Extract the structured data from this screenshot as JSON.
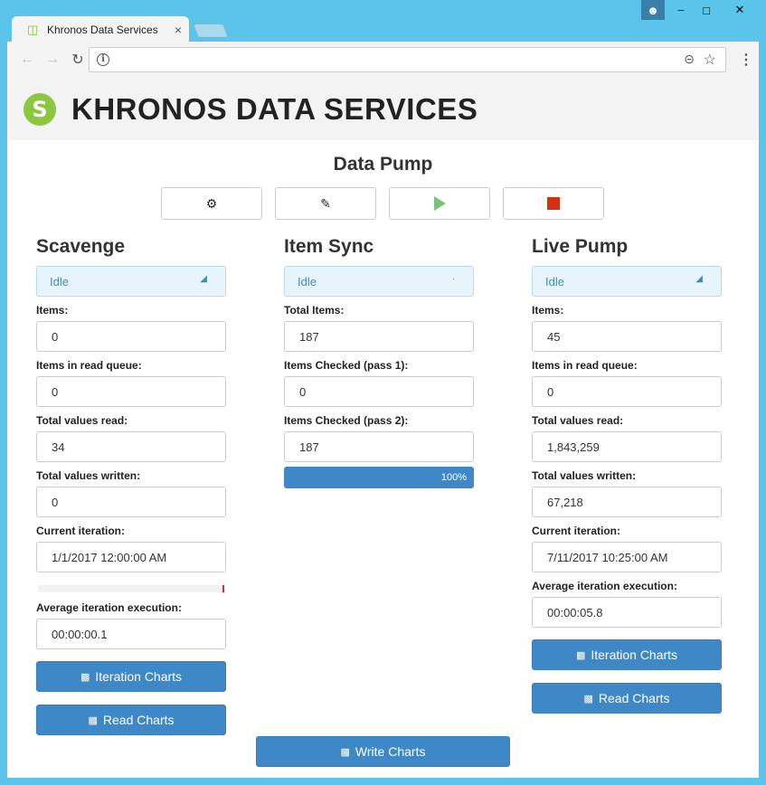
{
  "window": {
    "user_icon": "user-icon",
    "minimize": "−",
    "maximize": "□",
    "close": "✕"
  },
  "tab": {
    "title": "Khronos Data Services",
    "close": "×"
  },
  "toolbar": {
    "url": ""
  },
  "header": {
    "logo_glyph": "S",
    "title": "KHRONOS DATA SERVICES"
  },
  "page_title": "Data Pump",
  "controls": {
    "settings": "⚙",
    "edit": "📝"
  },
  "scavenge": {
    "heading": "Scavenge",
    "status": "Idle",
    "items_label": "Items:",
    "items": "0",
    "queue_label": "Items in read queue:",
    "queue": "0",
    "read_label": "Total values read:",
    "read": "34",
    "written_label": "Total values written:",
    "written": "0",
    "iter_label": "Current iteration:",
    "iter": "1/1/2017 12:00:00 AM",
    "avg_label": "Average iteration execution:",
    "avg": "00:00:00.1",
    "iter_charts": "Iteration Charts",
    "read_charts": "Read Charts"
  },
  "itemsync": {
    "heading": "Item Sync",
    "status": "Idle",
    "total_label": "Total Items:",
    "total": "187",
    "pass1_label": "Items Checked (pass 1):",
    "pass1": "0",
    "pass2_label": "Items Checked (pass 2):",
    "pass2": "187",
    "progress": "100%"
  },
  "livepump": {
    "heading": "Live Pump",
    "status": "Idle",
    "items_label": "Items:",
    "items": "45",
    "queue_label": "Items in read queue:",
    "queue": "0",
    "read_label": "Total values read:",
    "read": "1,843,259",
    "written_label": "Total values written:",
    "written": "67,218",
    "iter_label": "Current iteration:",
    "iter": "7/11/2017 10:25:00 AM",
    "avg_label": "Average iteration execution:",
    "avg": "00:00:05.8",
    "iter_charts": "Iteration Charts",
    "read_charts": "Read Charts"
  },
  "write_charts": "Write Charts",
  "colors": {
    "primary": "#3f88c8",
    "brand": "#8dc63f",
    "stop": "#d42f0f",
    "play": "#7ac27a"
  }
}
